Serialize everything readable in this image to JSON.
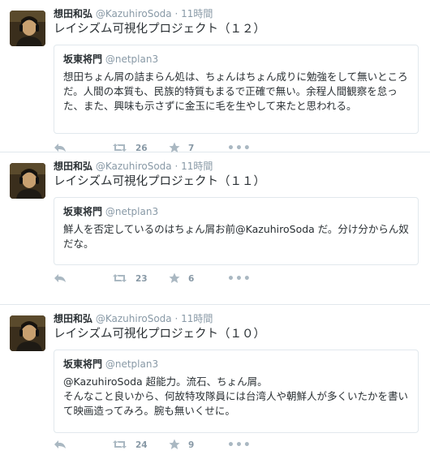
{
  "tweets": [
    {
      "fullname": "想田和弘",
      "username": "@KazuhiroSoda",
      "separator": "·",
      "time": "11時間",
      "text": "レイシズム可視化プロジェクト（１２）",
      "quote": {
        "fullname": "坂東将門",
        "username": "@netplan3",
        "lines": [
          "想田ちょん屑の詰まらん処は、ちょんはちょん成りに勉強をして無いところ",
          "だ。人間の本質も、民族的特質もまるで正確で無い。余程人間観察を怠っ",
          "た、また、興味も示さずに金玉に毛を生やして来たと思われる。"
        ]
      },
      "retweets": "26",
      "favorites": "7"
    },
    {
      "fullname": "想田和弘",
      "username": "@KazuhiroSoda",
      "separator": "·",
      "time": "11時間",
      "text": "レイシズム可視化プロジェクト（１１）",
      "quote": {
        "fullname": "坂東将門",
        "username": "@netplan3",
        "lines": [
          "鮮人を否定しているのはちょん屑お前@KazuhiroSoda だ。分け分からん奴",
          "だな。"
        ]
      },
      "retweets": "23",
      "favorites": "6"
    },
    {
      "fullname": "想田和弘",
      "username": "@KazuhiroSoda",
      "separator": "·",
      "time": "11時間",
      "text": "レイシズム可視化プロジェクト（１０）",
      "quote": {
        "fullname": "坂東将門",
        "username": "@netplan3",
        "lines": [
          "@KazuhiroSoda 超能力。流石、ちょん屑。",
          "そんなこと良いから、何故特攻隊員には台湾人や朝鮮人が多くいたかを書い",
          "て映画造ってみろ。腕も無いくせに。"
        ]
      },
      "retweets": "24",
      "favorites": "9"
    }
  ],
  "colors": {
    "text": "#292f33",
    "muted": "#8899a6",
    "border": "#e1e8ed",
    "icon": "#aab8c2"
  },
  "icons": {
    "reply": "reply-icon",
    "retweet": "retweet-icon",
    "favorite": "star-icon",
    "more": "more-icon"
  }
}
